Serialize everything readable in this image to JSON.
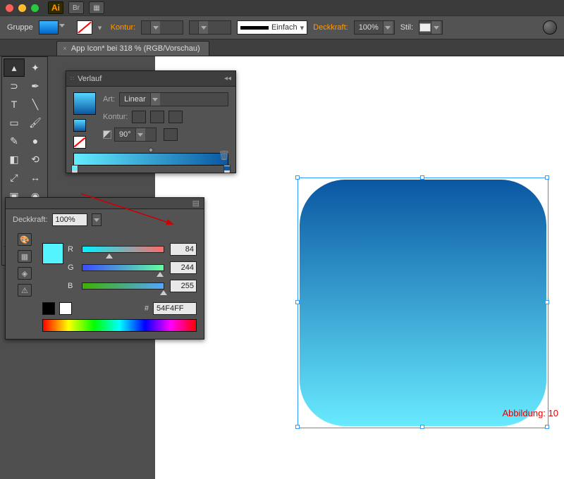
{
  "app": {
    "logo": "Ai"
  },
  "ctrl": {
    "group": "Gruppe",
    "kontur": "Kontur:",
    "stroke_style": "Einfach",
    "deckkraft_label": "Deckkraft:",
    "deckkraft_value": "100%",
    "stil": "Stil:"
  },
  "tab": {
    "title": "App Icon* bei 318 % (RGB/Vorschau)"
  },
  "gradient_panel": {
    "title": "Verlauf",
    "art_label": "Art:",
    "art_value": "Linear",
    "kontur_label": "Kontur:",
    "angle": "90°",
    "stop_left_color": "#64ecff",
    "stop_right_color": "#0a57a2"
  },
  "color_panel": {
    "deckkraft_label": "Deckkraft:",
    "deckkraft_value": "100%",
    "r_label": "R",
    "r_value": "84",
    "g_label": "G",
    "g_value": "244",
    "b_label": "B",
    "b_value": "255",
    "hex_label": "#",
    "hex_value": "54F4FF",
    "swatch_color": "#54F4FF"
  },
  "caption": "Abbildung: 10",
  "tools": [
    "⬚",
    "↖",
    "✦",
    "🖉",
    "T",
    "╱",
    "▭",
    "🖌",
    "✎",
    "✂",
    "⟲",
    "◧",
    "◉",
    "▦",
    "🔲",
    "📊",
    "◐",
    "↔",
    "🔍",
    "✋"
  ]
}
